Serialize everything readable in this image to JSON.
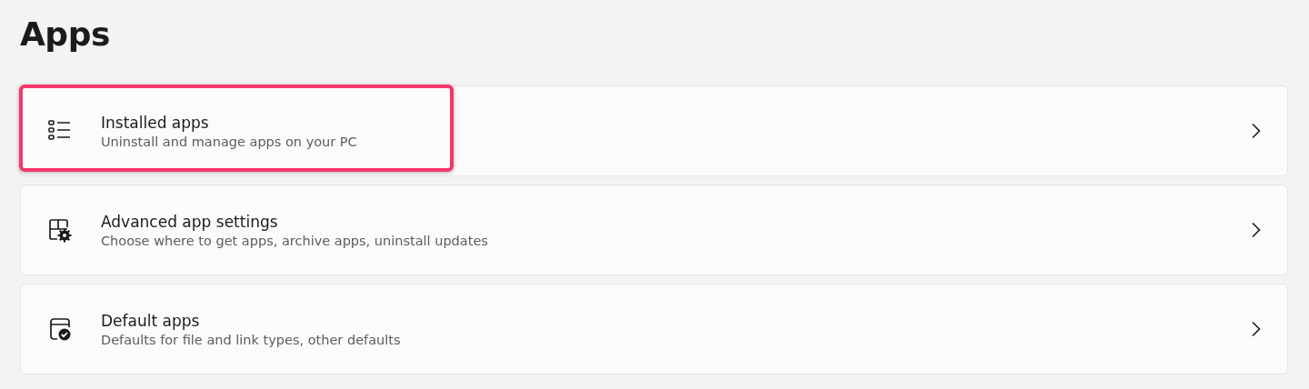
{
  "page": {
    "title": "Apps"
  },
  "items": [
    {
      "kind": "list",
      "title": "Installed apps",
      "subtitle": "Uninstall and manage apps on your PC",
      "highlighted": true
    },
    {
      "kind": "advanced",
      "title": "Advanced app settings",
      "subtitle": "Choose where to get apps, archive apps, uninstall updates",
      "highlighted": false
    },
    {
      "kind": "default",
      "title": "Default apps",
      "subtitle": "Defaults for file and link types, other defaults",
      "highlighted": false
    }
  ]
}
